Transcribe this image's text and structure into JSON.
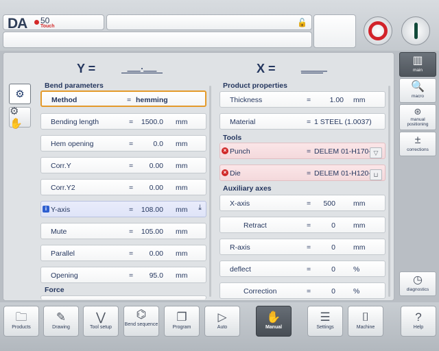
{
  "header": {
    "logo_text": "DA",
    "logo_model": "50",
    "logo_sub": "Touch",
    "lock_icon": "unlock-icon",
    "stop_icon": "stop-icon",
    "start_icon": "start-icon"
  },
  "axis": {
    "y_label": "Y =",
    "y_value": "__.__",
    "x_label": "X =",
    "x_value": "____"
  },
  "side_tabs": [
    {
      "name": "gears-icon",
      "active": true
    },
    {
      "name": "manual-gear-icon",
      "active": false
    }
  ],
  "bend_parameters": {
    "title": "Bend parameters",
    "rows": [
      {
        "label": "Method",
        "eq": "=",
        "value": "hemming",
        "unit": ""
      },
      {
        "label": "Bending length",
        "eq": "=",
        "value": "1500.0",
        "unit": "mm"
      },
      {
        "label": "Hem opening",
        "eq": "=",
        "value": "0.0",
        "unit": "mm"
      },
      {
        "label": "Corr.Y",
        "eq": "=",
        "value": "0.00",
        "unit": "mm"
      },
      {
        "label": "Corr.Y2",
        "eq": "=",
        "value": "0.00",
        "unit": "mm"
      },
      {
        "label": "Y-axis",
        "eq": "=",
        "value": "108.00",
        "unit": "mm"
      },
      {
        "label": "Mute",
        "eq": "=",
        "value": "105.00",
        "unit": "mm"
      },
      {
        "label": "Parallel",
        "eq": "=",
        "value": "0.00",
        "unit": "mm"
      },
      {
        "label": "Opening",
        "eq": "=",
        "value": "95.0",
        "unit": "mm"
      }
    ],
    "info_badge": "i"
  },
  "force": {
    "title": "Force"
  },
  "product_properties": {
    "title": "Product properties",
    "rows": [
      {
        "label": "Thickness",
        "eq": "=",
        "value": "1.00",
        "unit": "mm"
      },
      {
        "label": "Material",
        "eq": "=",
        "value": "1 STEEL (1.0037)",
        "unit": ""
      }
    ]
  },
  "tools": {
    "title": "Tools",
    "rows": [
      {
        "label": "Punch",
        "eq": "=",
        "value": "DELEM 01-H170-"
      },
      {
        "label": "Die",
        "eq": "=",
        "value": "DELEM 01-H120-"
      }
    ],
    "error_badge": "×"
  },
  "auxiliary_axes": {
    "title": "Auxiliary axes",
    "rows": [
      {
        "label": "X-axis",
        "eq": "=",
        "value": "500",
        "unit": "mm"
      },
      {
        "label": "Retract",
        "eq": "=",
        "value": "0",
        "unit": "mm"
      },
      {
        "label": "R-axis",
        "eq": "=",
        "value": "0",
        "unit": "mm"
      },
      {
        "label": "deflect",
        "eq": "=",
        "value": "0",
        "unit": "%"
      },
      {
        "label": "Correction",
        "eq": "=",
        "value": "0",
        "unit": "%"
      }
    ]
  },
  "right_sidebar": [
    {
      "label": "main",
      "icon": "main-icon",
      "active": true
    },
    {
      "label": "macro",
      "icon": "magnifier-icon",
      "active": false
    },
    {
      "label": "manual positioning",
      "icon": "positioning-icon",
      "active": false
    },
    {
      "label": "corrections",
      "icon": "plus-minus-icon",
      "active": false
    },
    {
      "label": "diagnostics",
      "icon": "gauge-icon",
      "active": false
    }
  ],
  "bottom_nav": [
    {
      "label": "Products",
      "icon": "folder-icon",
      "active": false
    },
    {
      "label": "Drawing",
      "icon": "drawing-icon",
      "active": false
    },
    {
      "label": "Tool setup",
      "icon": "tool-setup-icon",
      "active": false
    },
    {
      "label": "Bend sequence",
      "icon": "bend-sequence-icon",
      "active": false
    },
    {
      "label": "Program",
      "icon": "program-icon",
      "active": false
    },
    {
      "label": "Auto",
      "icon": "play-icon",
      "active": false
    },
    {
      "label": "Manual",
      "icon": "hand-icon",
      "active": true
    },
    {
      "label": "Settings",
      "icon": "settings-icon",
      "active": false
    },
    {
      "label": "Machine",
      "icon": "machine-icon",
      "active": false
    },
    {
      "label": "Help",
      "icon": "help-icon",
      "active": false
    }
  ]
}
